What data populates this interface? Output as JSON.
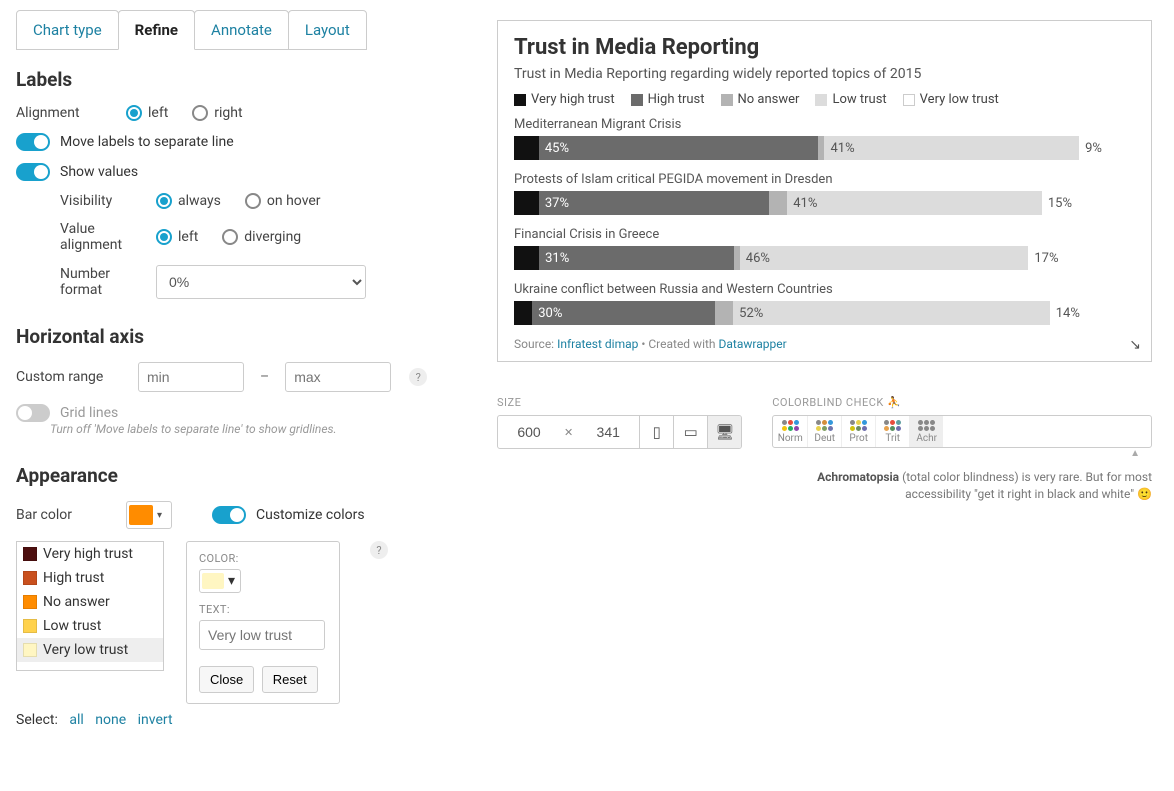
{
  "tabs": [
    "Chart type",
    "Refine",
    "Annotate",
    "Layout"
  ],
  "active_tab": 1,
  "labels": {
    "section": "Labels",
    "alignment": "Alignment",
    "align_left": "left",
    "align_right": "right",
    "move_separate": "Move labels to separate line",
    "show_values": "Show values",
    "visibility": "Visibility",
    "vis_always": "always",
    "vis_hover": "on hover",
    "value_align": "Value alignment",
    "va_left": "left",
    "va_diverging": "diverging",
    "number_format": "Number format",
    "nf_value": "0%"
  },
  "haxis": {
    "section": "Horizontal axis",
    "custom_range": "Custom range",
    "min_ph": "min",
    "max_ph": "max",
    "grid_lines": "Grid lines",
    "hint": "Turn off 'Move labels to separate line' to show gridlines."
  },
  "appearance": {
    "section": "Appearance",
    "bar_color": "Bar color",
    "bar_color_hex": "#ff8c00",
    "customize": "Customize colors",
    "list": [
      {
        "label": "Very high trust",
        "color": "#4d0f0f"
      },
      {
        "label": "High trust",
        "color": "#c9501e"
      },
      {
        "label": "No answer",
        "color": "#ff8c00"
      },
      {
        "label": "Low trust",
        "color": "#ffd24d"
      },
      {
        "label": "Very low trust",
        "color": "#fff6c2"
      }
    ],
    "selected_index": 4,
    "color_lbl": "COLOR:",
    "text_lbl": "TEXT:",
    "text_ph": "Very low trust",
    "close": "Close",
    "reset": "Reset",
    "select_label": "Select:",
    "sel_all": "all",
    "sel_none": "none",
    "sel_invert": "invert"
  },
  "chart": {
    "title": "Trust in Media Reporting",
    "subtitle": "Trust in Media Reporting regarding widely reported topics of 2015",
    "source_prefix": "Source: ",
    "source_name": "Infratest dimap",
    "created_prefix": " • Created with ",
    "created_tool": "Datawrapper"
  },
  "chart_data": {
    "type": "bar",
    "legend": [
      {
        "name": "Very high trust",
        "color": "#111111"
      },
      {
        "name": "High trust",
        "color": "#6b6b6b"
      },
      {
        "name": "No answer",
        "color": "#b3b3b3"
      },
      {
        "name": "Low trust",
        "color": "#dcdcdc"
      },
      {
        "name": "Very low trust",
        "color": "#ffffff"
      }
    ],
    "rows": [
      {
        "label": "Mediterranean Migrant Crisis",
        "segments": [
          {
            "v": 4,
            "show": false
          },
          {
            "v": 45,
            "show": true
          },
          {
            "v": 1,
            "show": false
          },
          {
            "v": 41,
            "show": true
          },
          {
            "v": 9,
            "show": true
          }
        ]
      },
      {
        "label": "Protests of Islam critical PEGIDA movement in Dresden",
        "segments": [
          {
            "v": 4,
            "show": false
          },
          {
            "v": 37,
            "show": true
          },
          {
            "v": 3,
            "show": false
          },
          {
            "v": 41,
            "show": true
          },
          {
            "v": 15,
            "show": true
          }
        ]
      },
      {
        "label": "Financial Crisis in Greece",
        "segments": [
          {
            "v": 4,
            "show": false
          },
          {
            "v": 31,
            "show": true
          },
          {
            "v": 1,
            "show": false
          },
          {
            "v": 46,
            "show": true
          },
          {
            "v": 17,
            "show": true
          }
        ]
      },
      {
        "label": "Ukraine conflict between Russia and Western Countries",
        "segments": [
          {
            "v": 3,
            "show": false
          },
          {
            "v": 30,
            "show": true
          },
          {
            "v": 3,
            "show": false
          },
          {
            "v": 52,
            "show": true
          },
          {
            "v": 14,
            "show": true
          }
        ]
      }
    ]
  },
  "size": {
    "label": "SIZE",
    "w": "600",
    "h": "341"
  },
  "colorblind": {
    "label": "COLORBLIND CHECK",
    "buttons": [
      "Norm",
      "Deut",
      "Prot",
      "Trit",
      "Achr"
    ],
    "active": 4,
    "palettes": [
      [
        "#888",
        "#e74c3c",
        "#3498db",
        "#f1c40f",
        "#27ae60",
        "#8e44ad"
      ],
      [
        "#888",
        "#d48f3c",
        "#3498db",
        "#e8d24d",
        "#7f9e60",
        "#6e74ad"
      ],
      [
        "#888",
        "#e8d24d",
        "#3498db",
        "#d1c40f",
        "#6e8e60",
        "#6e6ead"
      ],
      [
        "#888",
        "#e74c3c",
        "#5f9ea0",
        "#e8a24d",
        "#578e60",
        "#6e6ead"
      ],
      [
        "#888",
        "#888",
        "#888",
        "#888",
        "#888",
        "#888"
      ]
    ],
    "note_b": "Achromatopsia",
    "note_rest": " (total color blindness) is very rare. But for most accessibility \"get it right in black and white\" 🙂"
  }
}
